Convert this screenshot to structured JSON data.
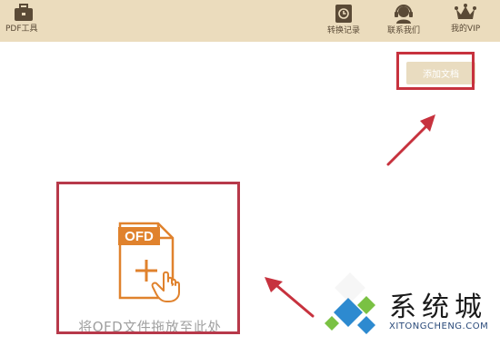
{
  "toolbar": {
    "pdf_tool_label": "PDF工具",
    "history_label": "转换记录",
    "contact_label": "联系我们",
    "vip_label": "我的VIP"
  },
  "actions": {
    "add_document_label": "添加文档"
  },
  "drop_zone": {
    "file_badge": "OFD",
    "hint": "将OFD文件拖放至此处"
  },
  "watermark": {
    "title": "系统城",
    "site": "XITONGCHENG.COM"
  },
  "colors": {
    "toolbar_bg": "#ebdcbd",
    "accent_orange": "#e0822d",
    "highlight_red": "#c7323e"
  },
  "icons": {
    "pdf_tool": "briefcase-icon",
    "history": "history-icon",
    "contact": "headset-icon",
    "vip": "crown-icon",
    "drop": "ofd-file-add-icon",
    "drag": "hand-pointer-icon"
  }
}
